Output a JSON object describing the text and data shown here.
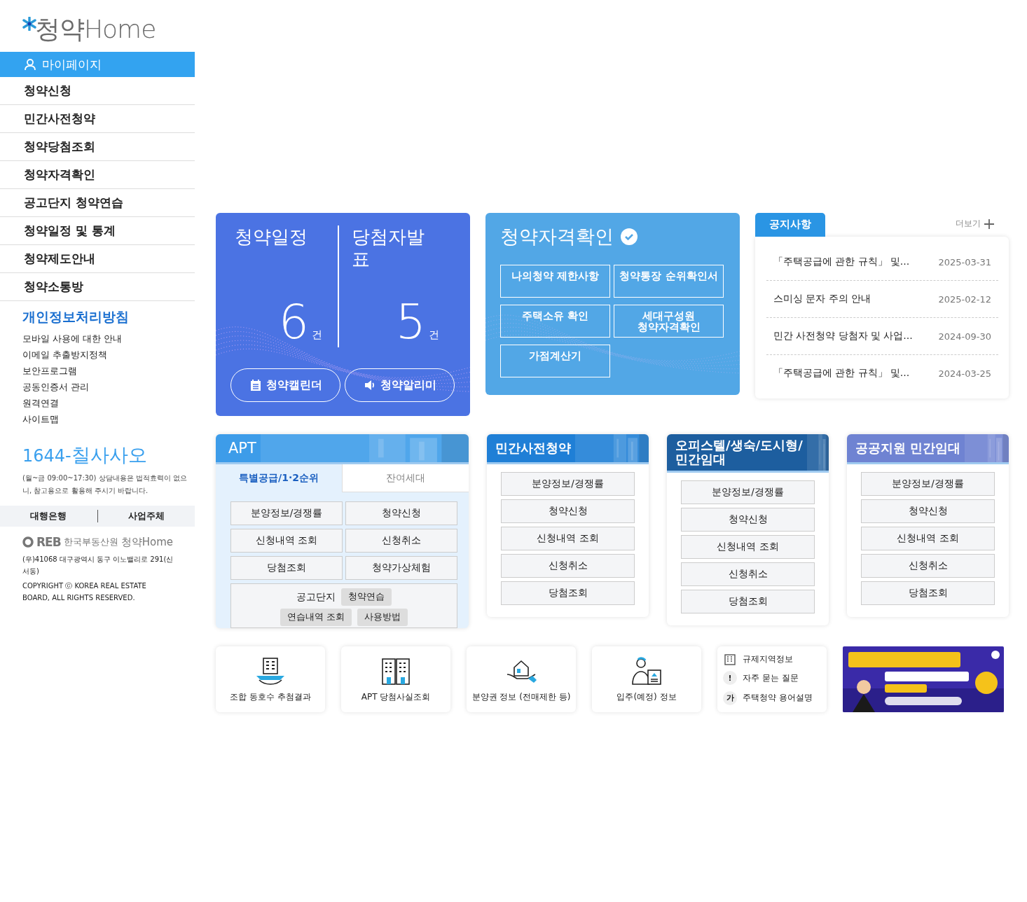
{
  "sidebar": {
    "logo": {
      "text": "청약Home"
    },
    "menu": [
      {
        "label": "마이페이지",
        "selected": true
      },
      {
        "label": "청약신청",
        "selected": false
      },
      {
        "label": "민간사전청약",
        "selected": false
      },
      {
        "label": "청약당첨조회",
        "selected": false
      },
      {
        "label": "청약자격확인",
        "selected": false
      },
      {
        "label": "공고단지 청약연습",
        "selected": false
      },
      {
        "label": "청약일정 및 통계",
        "selected": false
      },
      {
        "label": "청약제도안내",
        "selected": false
      },
      {
        "label": "청약소통방",
        "selected": false
      }
    ],
    "policy_title": "개인정보처리방침",
    "links": [
      "모바일 사용에 대한 안내",
      "이메일 추출방지정책",
      "보안프로그램",
      "공동인증서 관리",
      "원격연결",
      "사이트맵"
    ],
    "phone": {
      "digits": "1644-",
      "words": "칠사사오"
    },
    "phone_note": "(월~금 09:00~17:30) 상담내용은 법적효력이 없으니, 참고용으로 활용해 주시기 바랍니다.",
    "footer_tabs": [
      "대행은행",
      "사업주체"
    ],
    "footer_logo": {
      "mark": "REB",
      "org": "한국부동산원",
      "brand": "청약Home"
    },
    "address": "(우)41068 대구광역시 동구 이노밸리로 291(신서동)",
    "copyright": "COPYRIGHT ⓒ KOREA REAL ESTATE BOARD, ALL RIGHTS RESERVED."
  },
  "schedule_card": {
    "sections": [
      {
        "title": "청약일정",
        "count": "6",
        "unit": "건"
      },
      {
        "title": "당첨자발표",
        "count": "5",
        "unit": "건"
      }
    ],
    "buttons": [
      {
        "label": "청약캘린더",
        "kind": "calendar"
      },
      {
        "label": "청약알리미",
        "kind": "speaker"
      }
    ]
  },
  "eligibility_card": {
    "title": "청약자격확인",
    "buttons": [
      "나의청약 제한사항",
      "청약통장 순위확인서",
      "주택소유 확인",
      "세대구성원\n청약자격확인",
      "가점계산기"
    ]
  },
  "notices": {
    "tab": "공지사항",
    "more": "더보기",
    "items": [
      {
        "title": "「주택공급에 관한 규칙」 및…",
        "date": "2025-03-31"
      },
      {
        "title": "스미싱 문자 주의 안내",
        "date": "2025-02-12"
      },
      {
        "title": "민간 사전청약 당첨자 및 사업…",
        "date": "2024-09-30"
      },
      {
        "title": "「주택공급에 관한 규칙」 및…",
        "date": "2024-03-25"
      }
    ]
  },
  "categories": [
    {
      "title": "APT",
      "kind": "tabs",
      "tabs": [
        {
          "label": "특별공급/1·2순위",
          "selected": true
        },
        {
          "label": "잔여세대",
          "selected": false
        }
      ],
      "buttons": [
        "분양정보/경쟁률",
        "청약신청",
        "신청내역 조회",
        "신청취소",
        "당첨조회",
        "청약가상체험"
      ],
      "practice": {
        "label": "공고단지",
        "buttons": [
          "청약연습",
          "연습내역 조회",
          "사용방법"
        ]
      }
    },
    {
      "title": "민간사전청약",
      "kind": "list",
      "buttons": [
        "분양정보/경쟁률",
        "청약신청",
        "신청내역 조회",
        "신청취소",
        "당첨조회"
      ]
    },
    {
      "title": "오피스텔/생숙/도시형/\n민간임대",
      "kind": "list",
      "buttons": [
        "분양정보/경쟁률",
        "청약신청",
        "신청내역 조회",
        "신청취소",
        "당첨조회"
      ]
    },
    {
      "title": "공공지원 민간임대",
      "kind": "list",
      "buttons": [
        "분양정보/경쟁률",
        "청약신청",
        "신청내역 조회",
        "신청취소",
        "당첨조회"
      ]
    }
  ],
  "quick_links": [
    {
      "label": "조합 동호수 추첨결과",
      "kind": "hand-building"
    },
    {
      "label": "APT 당첨사실조회",
      "kind": "buildings"
    },
    {
      "label": "분양권 정보 (전매제한 등)",
      "kind": "hand-house"
    },
    {
      "label": "입주(예정) 정보",
      "kind": "person-document"
    }
  ],
  "info_links": [
    {
      "label": "규제지역정보",
      "kind": "building"
    },
    {
      "label": "자주 묻는 질문",
      "kind": "glyph",
      "glyph": "!"
    },
    {
      "label": "주택청약 용어설명",
      "kind": "glyph",
      "glyph": "가"
    }
  ]
}
